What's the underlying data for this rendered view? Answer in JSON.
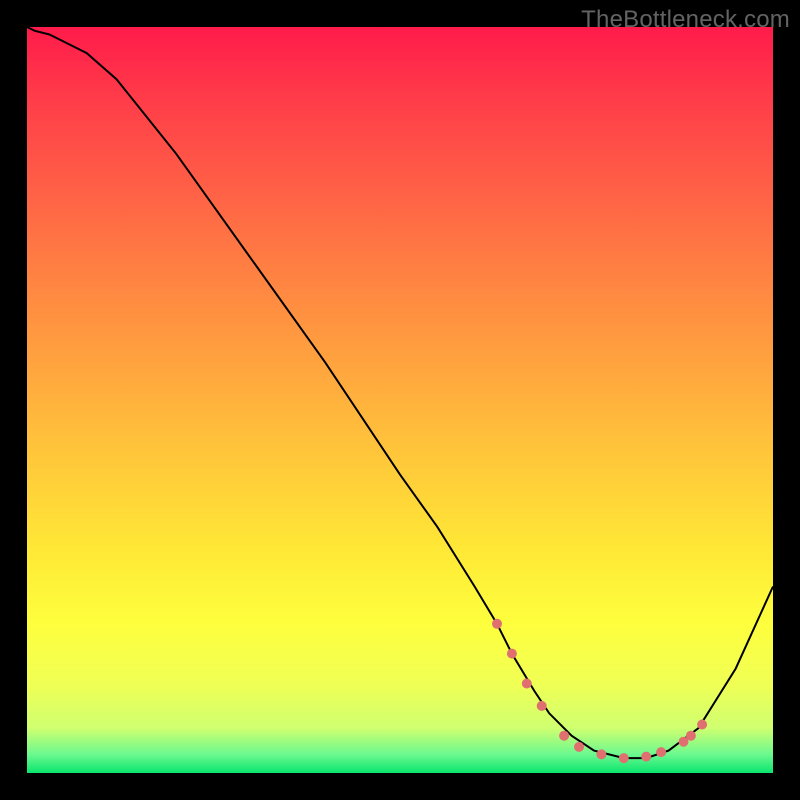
{
  "watermark": "TheBottleneck.com",
  "chart_data": {
    "type": "line",
    "title": "",
    "xlabel": "",
    "ylabel": "",
    "xlim": [
      0,
      100
    ],
    "ylim": [
      0,
      100
    ],
    "grid": false,
    "legend": false,
    "background_gradient": {
      "direction": "vertical",
      "stops": [
        {
          "pos": 0,
          "color": "#ff1b4a"
        },
        {
          "pos": 40,
          "color": "#ff9640"
        },
        {
          "pos": 75,
          "color": "#fff038"
        },
        {
          "pos": 97,
          "color": "#6cf98f"
        },
        {
          "pos": 100,
          "color": "#09e56e"
        }
      ]
    },
    "series": [
      {
        "name": "curve",
        "color": "#000000",
        "stroke_width": 2,
        "x": [
          0,
          1,
          3,
          5,
          8,
          12,
          20,
          30,
          40,
          50,
          55,
          60,
          63,
          65,
          68,
          70,
          73,
          76,
          80,
          83,
          86,
          90,
          95,
          100
        ],
        "y": [
          100,
          99.5,
          99,
          98,
          96.5,
          93,
          83,
          69,
          55,
          40,
          33,
          25,
          20,
          16,
          11,
          8,
          5,
          3,
          2,
          2,
          3,
          6,
          14,
          25
        ]
      }
    ],
    "markers": {
      "name": "dots",
      "color": "#e07070",
      "radius": 5,
      "points": [
        {
          "x": 63,
          "y": 20
        },
        {
          "x": 65,
          "y": 16
        },
        {
          "x": 67,
          "y": 12
        },
        {
          "x": 69,
          "y": 9
        },
        {
          "x": 72,
          "y": 5
        },
        {
          "x": 74,
          "y": 3.5
        },
        {
          "x": 77,
          "y": 2.5
        },
        {
          "x": 80,
          "y": 2
        },
        {
          "x": 83,
          "y": 2.2
        },
        {
          "x": 85,
          "y": 2.8
        },
        {
          "x": 88,
          "y": 4.2
        },
        {
          "x": 89,
          "y": 5
        },
        {
          "x": 90.5,
          "y": 6.5
        }
      ]
    }
  }
}
